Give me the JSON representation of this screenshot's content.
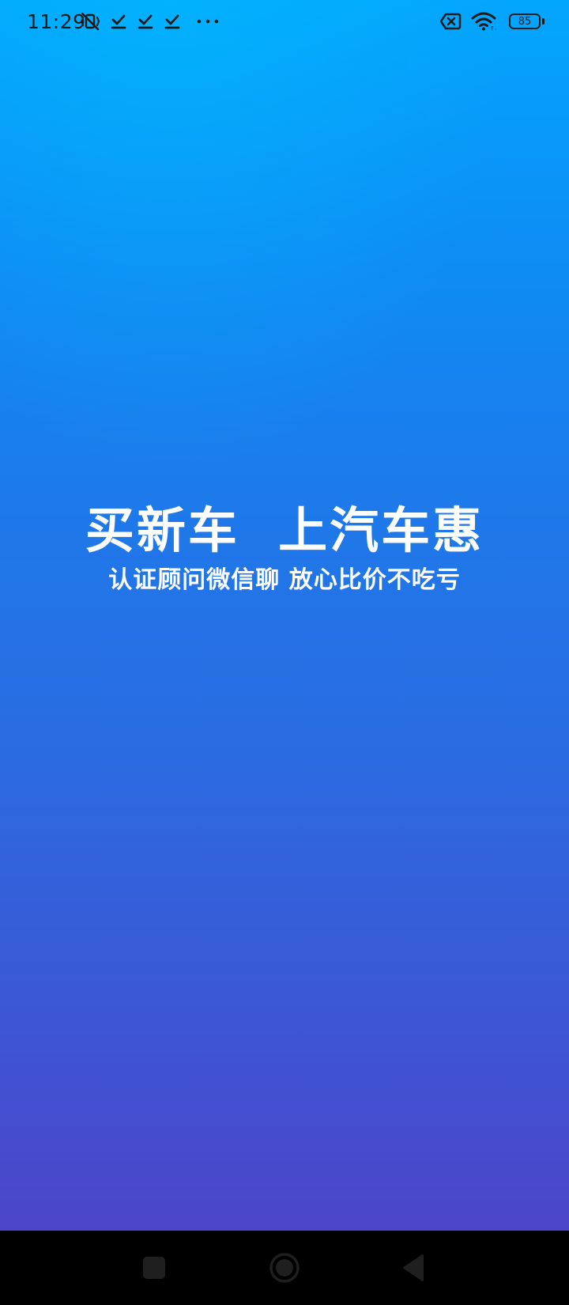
{
  "status_bar": {
    "time": "11:29",
    "battery_level": "85",
    "left_icons": [
      "vibrate-off-icon",
      "download-done-icon",
      "download-done-icon",
      "download-done-icon",
      "more-dots-icon"
    ],
    "right_icons": [
      "sim-error-icon",
      "wifi-icon",
      "battery-icon"
    ],
    "icon_color": "#1b1b1b"
  },
  "splash": {
    "headline": "买新车  上汽车惠",
    "subline": "认证顾问微信聊 放心比价不吃亏",
    "gradient_top": "#03a6fd",
    "gradient_bottom": "#4c45c9",
    "text_color": "#ffffff"
  },
  "nav_bar": {
    "buttons": [
      "recent-apps-button",
      "home-button",
      "back-button"
    ],
    "background": "#000000"
  }
}
